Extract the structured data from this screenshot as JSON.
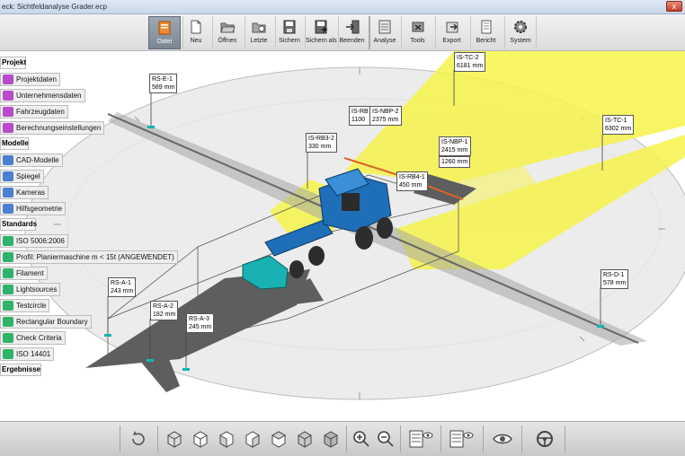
{
  "window": {
    "title": "eck: Sichtfeldanalyse Grader.ecp",
    "close_label": "x"
  },
  "toolbar": {
    "items": [
      {
        "label": "Datei",
        "icon": "file-icon"
      },
      {
        "label": "Neu",
        "icon": "new-document-icon"
      },
      {
        "label": "Öffnen",
        "icon": "folder-open-icon"
      },
      {
        "label": "Letzte",
        "icon": "recent-folder-icon"
      },
      {
        "label": "Sichern",
        "icon": "save-icon"
      },
      {
        "label": "Sichern als",
        "icon": "save-as-icon"
      },
      {
        "label": "Beenden",
        "icon": "exit-icon"
      },
      {
        "label": "Analyse",
        "icon": "analysis-icon"
      },
      {
        "label": "Tools",
        "icon": "tools-icon"
      },
      {
        "label": "Export",
        "icon": "export-icon"
      },
      {
        "label": "Bericht",
        "icon": "report-icon"
      },
      {
        "label": "System",
        "icon": "gear-icon"
      }
    ]
  },
  "tree": {
    "projekt": "Projekt",
    "projekt_items": [
      "Projektdaten",
      "Unternehmensdaten",
      "Fahrzeugdaten",
      "Berechnungseinstellungen"
    ],
    "modelle": "Modelle",
    "modelle_items": [
      "CAD-Modelle",
      "Spiegel",
      "Kameras",
      "Hilfsgeometrie"
    ],
    "standards": "Standards",
    "standards_items": [
      "ISO 5006:2006",
      "Profil: Planiermaschine  m < 15t (ANGEWENDET)",
      "Filament",
      "Lightsources",
      "Testcircle",
      "Rectangular Boundary",
      "Check Criteria",
      "ISO 14401"
    ],
    "ergebnisse": "Ergebnisse"
  },
  "measurements": [
    {
      "name": "RS-E-1",
      "value": "589 mm"
    },
    {
      "name": "IS-TC-2",
      "value": "6181 mm"
    },
    {
      "name": "IS-RB",
      "value": "1100"
    },
    {
      "name": "IS-NBP-2",
      "value": "2375 mm"
    },
    {
      "name": "IS-TC-1",
      "value": "6302 mm"
    },
    {
      "name": "IS-RB3-2",
      "value": "330 mm"
    },
    {
      "name": "IS-NBP-1",
      "value": "2415 mm"
    },
    {
      "name": "",
      "value": "1260 mm"
    },
    {
      "name": "IS-RB4-1",
      "value": "450 mm"
    },
    {
      "name": "RS-A-1",
      "value": "243 mm"
    },
    {
      "name": "RS-A-2",
      "value": "182 mm"
    },
    {
      "name": "RS-A-3",
      "value": "245 mm"
    },
    {
      "name": "RS-D-1",
      "value": "578 mm"
    }
  ],
  "bottom_toolbar": {
    "items": [
      {
        "icon": "rotate-icon"
      },
      {
        "icon": "view-cube-front-icon"
      },
      {
        "icon": "view-cube-back-icon"
      },
      {
        "icon": "view-cube-left-icon"
      },
      {
        "icon": "view-cube-right-icon"
      },
      {
        "icon": "view-cube-top-icon"
      },
      {
        "icon": "view-cube-bottom-icon"
      },
      {
        "icon": "view-cube-iso-icon"
      },
      {
        "icon": "zoom-in-icon"
      },
      {
        "icon": "zoom-out-icon"
      },
      {
        "icon": "layer-visibility-icon"
      },
      {
        "icon": "model-visibility-icon"
      },
      {
        "icon": "eye-icon"
      },
      {
        "icon": "steering-wheel-icon"
      }
    ]
  },
  "colors": {
    "visibility_cone": "#f6f44a",
    "vehicle": "#1f6fb8",
    "boundary": "#e0632a",
    "shadow": "#5d5d5d",
    "test_circle": "#eaeaea",
    "marker": "#19b2b2"
  }
}
